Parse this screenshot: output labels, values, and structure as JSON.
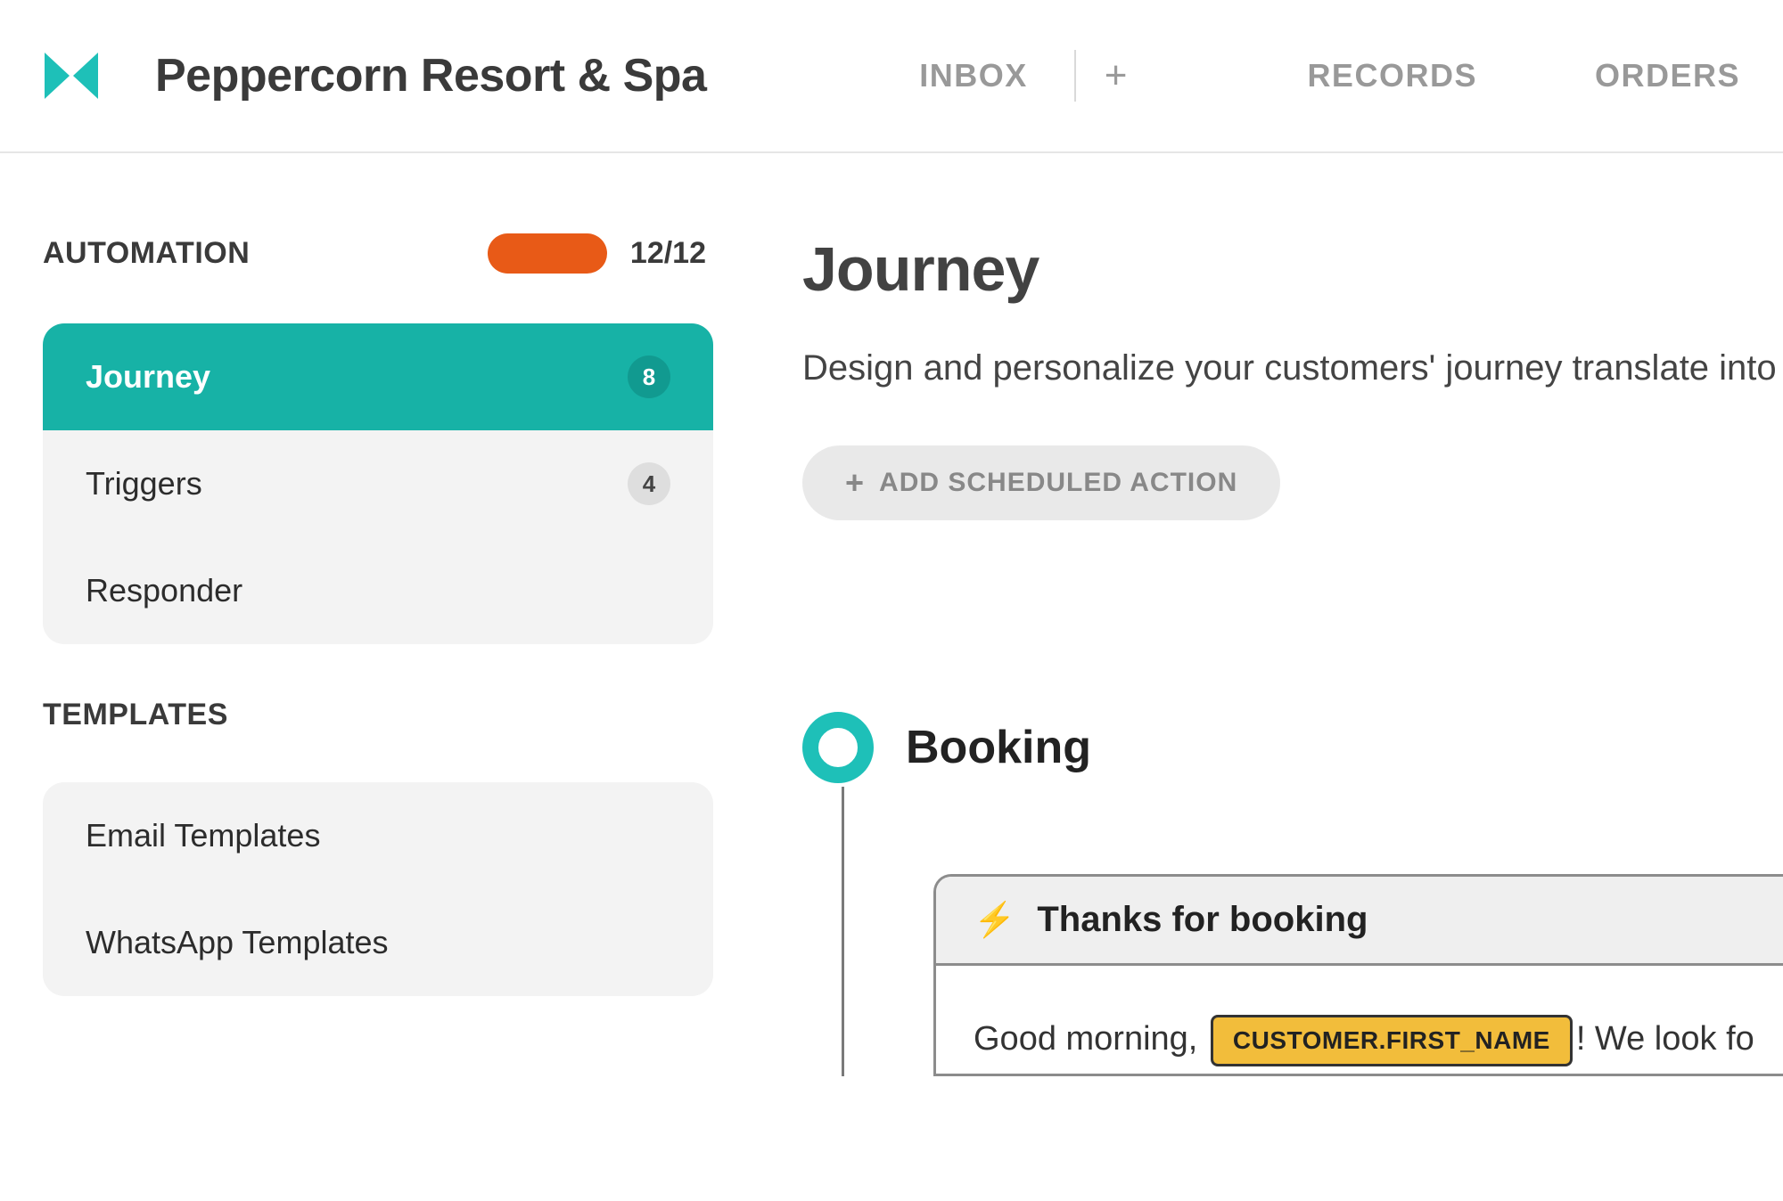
{
  "header": {
    "org_name": "Peppercorn Resort & Spa",
    "nav": {
      "inbox": "INBOX",
      "records": "RECORDS",
      "orders": "ORDERS"
    }
  },
  "sidebar": {
    "sections": {
      "automation": {
        "title": "AUTOMATION",
        "badge_text": "12/12",
        "items": [
          {
            "label": "Journey",
            "count": "8",
            "active": true
          },
          {
            "label": "Triggers",
            "count": "4",
            "active": false
          },
          {
            "label": "Responder",
            "count": "",
            "active": false
          }
        ]
      },
      "templates": {
        "title": "TEMPLATES",
        "items": [
          {
            "label": "Email Templates"
          },
          {
            "label": "WhatsApp Templates"
          }
        ]
      }
    }
  },
  "main": {
    "title": "Journey",
    "description": "Design and personalize your customers' journey translate into workflows with your team.",
    "add_button": "ADD SCHEDULED ACTION",
    "stage": {
      "title": "Booking",
      "card": {
        "title": "Thanks for booking",
        "body_prefix": "Good morning, ",
        "token": "CUSTOMER.FIRST_NAME",
        "body_suffix": "! We look fo"
      }
    }
  }
}
